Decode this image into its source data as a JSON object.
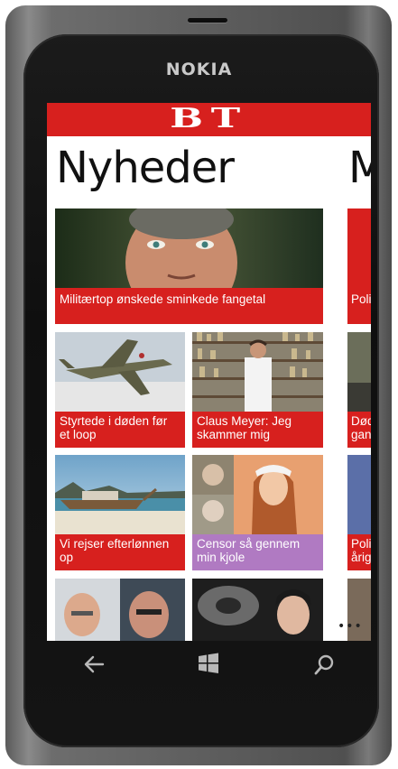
{
  "device": {
    "brand": "NOKIA"
  },
  "app": {
    "logo": "BT",
    "section_title": "Nyheder",
    "next_section_peek": "M",
    "colors": {
      "accent": "#d7201e",
      "lilac": "#b07ac2"
    }
  },
  "tiles": [
    {
      "caption": "Militærtop ønskede sminkede fangetal"
    },
    {
      "caption": "Styrtede i døden før et loop"
    },
    {
      "caption": "Claus Meyer: Jeg skammer mig"
    },
    {
      "caption": "Vi rejser efterlønnen op"
    },
    {
      "caption": "Censor så gennem min kjole"
    }
  ],
  "peek_tiles": [
    {
      "caption": "Poli"
    },
    {
      "caption": "Død gan"
    },
    {
      "caption": "Poli årig"
    }
  ],
  "appbar": {
    "more": "•••"
  },
  "hardware": {
    "back_icon": "back-arrow-icon",
    "start_icon": "windows-logo-icon",
    "search_icon": "search-icon"
  }
}
